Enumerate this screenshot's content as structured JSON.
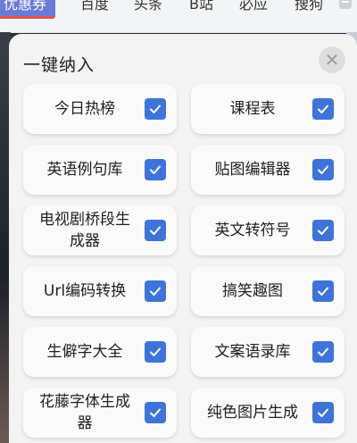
{
  "background_tabs": [
    "优惠券",
    "百度",
    "头条",
    "B站",
    "必应",
    "搜狗"
  ],
  "sheet": {
    "title": "一键纳入",
    "close_icon": "close-icon"
  },
  "items": [
    {
      "label": "今日热榜",
      "checked": true
    },
    {
      "label": "课程表",
      "checked": true
    },
    {
      "label": "英语例句库",
      "checked": true
    },
    {
      "label": "贴图编辑器",
      "checked": true
    },
    {
      "label": "电视剧桥段生成器",
      "checked": true
    },
    {
      "label": "英文转符号",
      "checked": true
    },
    {
      "label": "Url编码转换",
      "checked": true
    },
    {
      "label": "搞笑趣图",
      "checked": true
    },
    {
      "label": "生僻字大全",
      "checked": true
    },
    {
      "label": "文案语录库",
      "checked": true
    },
    {
      "label": "花藤字体生成器",
      "checked": true
    },
    {
      "label": "纯色图片生成",
      "checked": true
    }
  ],
  "colors": {
    "checkbox": "#3e74d9",
    "sheet_bg": "#f3f3f3",
    "tile_bg": "#fafafa"
  }
}
